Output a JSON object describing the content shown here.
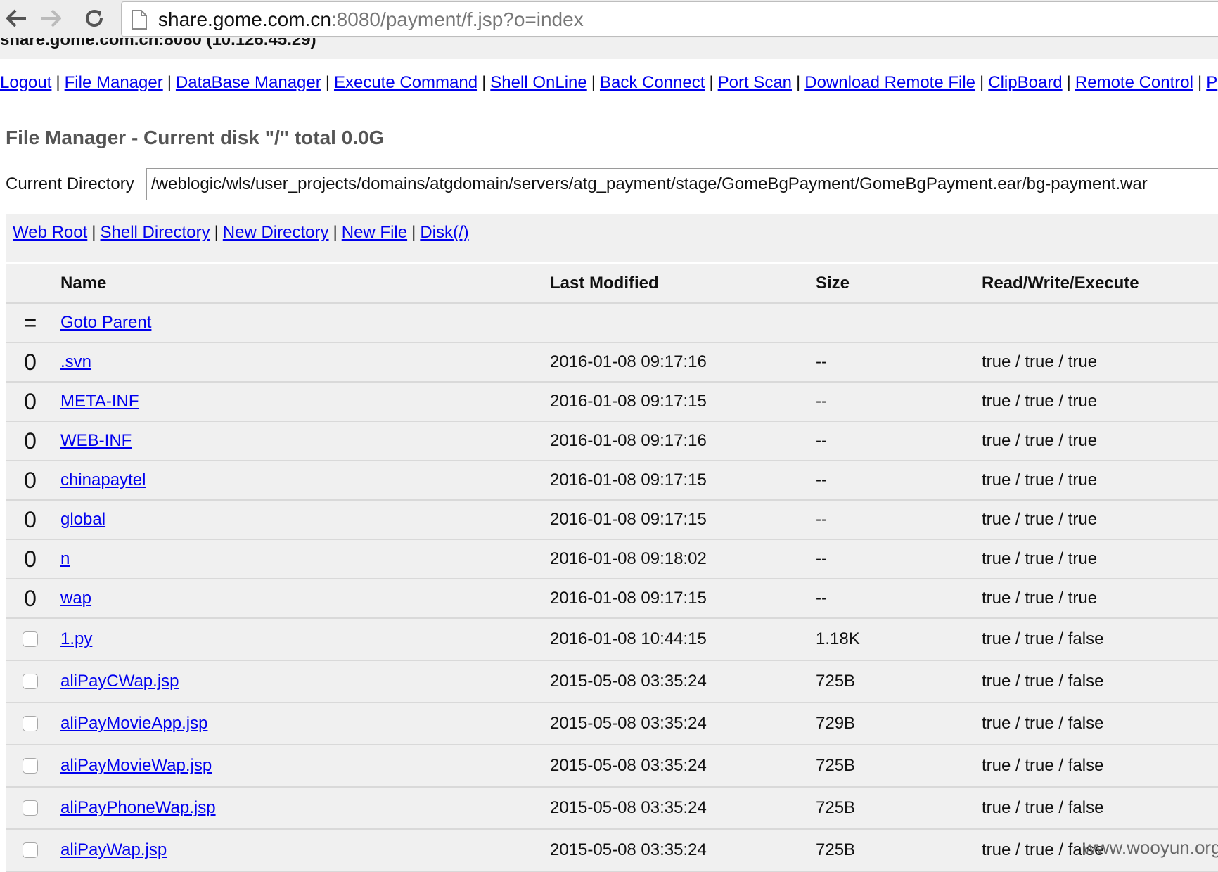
{
  "browser": {
    "url_host": "share.gome.com.cn",
    "url_rest": ":8080/payment/f.jsp?o=index"
  },
  "page": {
    "host_info": "share.gome.com.cn:8080 (10.126.45.29)",
    "menu": [
      "Logout",
      "File Manager",
      "DataBase Manager",
      "Execute Command",
      "Shell OnLine",
      "Back Connect",
      "Port Scan",
      "Download Remote File",
      "ClipBoard",
      "Remote Control",
      "P"
    ],
    "title": "File Manager - Current disk \"/\" total 0.0G",
    "current_dir_label": "Current Directory",
    "current_dir_value": "/weblogic/wls/user_projects/domains/atgdomain/servers/atg_payment/stage/GomeBgPayment/GomeBgPayment.ear/bg-payment.war",
    "toolbar": [
      "Web Root",
      "Shell Directory",
      "New Directory",
      "New File",
      "Disk(/)"
    ],
    "table": {
      "headers": {
        "name": "Name",
        "modified": "Last Modified",
        "size": "Size",
        "perm": "Read/Write/Execute"
      },
      "parent": {
        "marker": "=",
        "label": "Goto Parent"
      },
      "dirs": [
        {
          "marker": "0",
          "name": ".svn",
          "modified": "2016-01-08 09:17:16",
          "size": "--",
          "perm": "true / true / true"
        },
        {
          "marker": "0",
          "name": "META-INF",
          "modified": "2016-01-08 09:17:15",
          "size": "--",
          "perm": "true / true / true"
        },
        {
          "marker": "0",
          "name": "WEB-INF",
          "modified": "2016-01-08 09:17:16",
          "size": "--",
          "perm": "true / true / true"
        },
        {
          "marker": "0",
          "name": "chinapaytel",
          "modified": "2016-01-08 09:17:15",
          "size": "--",
          "perm": "true / true / true"
        },
        {
          "marker": "0",
          "name": "global",
          "modified": "2016-01-08 09:17:15",
          "size": "--",
          "perm": "true / true / true"
        },
        {
          "marker": "0",
          "name": "n",
          "modified": "2016-01-08 09:18:02",
          "size": "--",
          "perm": "true / true / true"
        },
        {
          "marker": "0",
          "name": "wap",
          "modified": "2016-01-08 09:17:15",
          "size": "--",
          "perm": "true / true / true"
        }
      ],
      "files": [
        {
          "name": "1.py",
          "modified": "2016-01-08 10:44:15",
          "size": "1.18K",
          "perm": "true / true / false"
        },
        {
          "name": "aliPayCWap.jsp",
          "modified": "2015-05-08 03:35:24",
          "size": "725B",
          "perm": "true / true / false"
        },
        {
          "name": "aliPayMovieApp.jsp",
          "modified": "2015-05-08 03:35:24",
          "size": "729B",
          "perm": "true / true / false"
        },
        {
          "name": "aliPayMovieWap.jsp",
          "modified": "2015-05-08 03:35:24",
          "size": "725B",
          "perm": "true / true / false"
        },
        {
          "name": "aliPayPhoneWap.jsp",
          "modified": "2015-05-08 03:35:24",
          "size": "725B",
          "perm": "true / true / false"
        },
        {
          "name": "aliPayWap.jsp",
          "modified": "2015-05-08 03:35:24",
          "size": "725B",
          "perm": "true / true / false"
        }
      ]
    },
    "watermark": "www.wooyun.org"
  }
}
